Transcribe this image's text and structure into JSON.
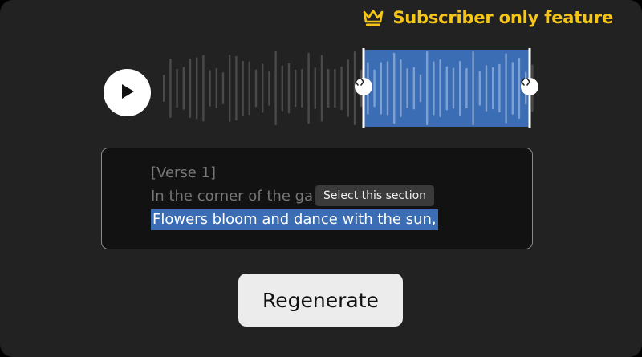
{
  "badge": {
    "label": "Subscriber only feature",
    "icon": "crown-icon",
    "color": "#f5c518"
  },
  "player": {
    "play_icon": "play-icon",
    "selection_color": "#3a6db3",
    "left_handle_icon": "drag-handle-icon",
    "right_handle_icon": "drag-handle-icon"
  },
  "lyrics": {
    "lines": [
      "[Verse 1]",
      "In the corner of the ga",
      "Flowers bloom and dance with the sun,"
    ],
    "tooltip": "Select this section"
  },
  "regenerate_label": "Regenerate"
}
